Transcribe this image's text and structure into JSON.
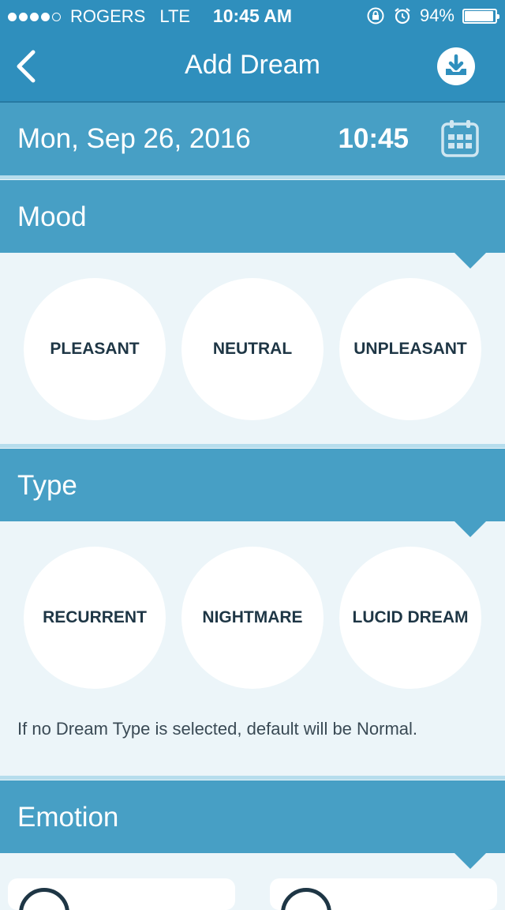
{
  "status_bar": {
    "carrier": "ROGERS",
    "network": "LTE",
    "time": "10:45 AM",
    "battery": "94%",
    "battery_level": 0.94,
    "signal_bars": 4,
    "icons": [
      "orientation-lock-icon",
      "alarm-icon",
      "battery-icon"
    ]
  },
  "nav": {
    "title": "Add Dream",
    "back_icon": "chevron-left-icon",
    "save_icon": "download-tray-icon"
  },
  "date_row": {
    "date": "Mon, Sep 26, 2016",
    "time": "10:45",
    "calendar_icon": "calendar-icon"
  },
  "mood": {
    "header": "Mood",
    "options": [
      "PLEASANT",
      "NEUTRAL",
      "UNPLEASANT"
    ]
  },
  "type": {
    "header": "Type",
    "options": [
      "RECURRENT",
      "NIGHTMARE",
      "LUCID DREAM"
    ],
    "note": "If no Dream Type is selected, default will be Normal."
  },
  "emotion": {
    "header": "Emotion"
  },
  "colors": {
    "nav_bg": "#2f8fbd",
    "section_bg": "#479fc5",
    "content_bg": "#ecf5f9",
    "option_text": "#1e3645"
  }
}
